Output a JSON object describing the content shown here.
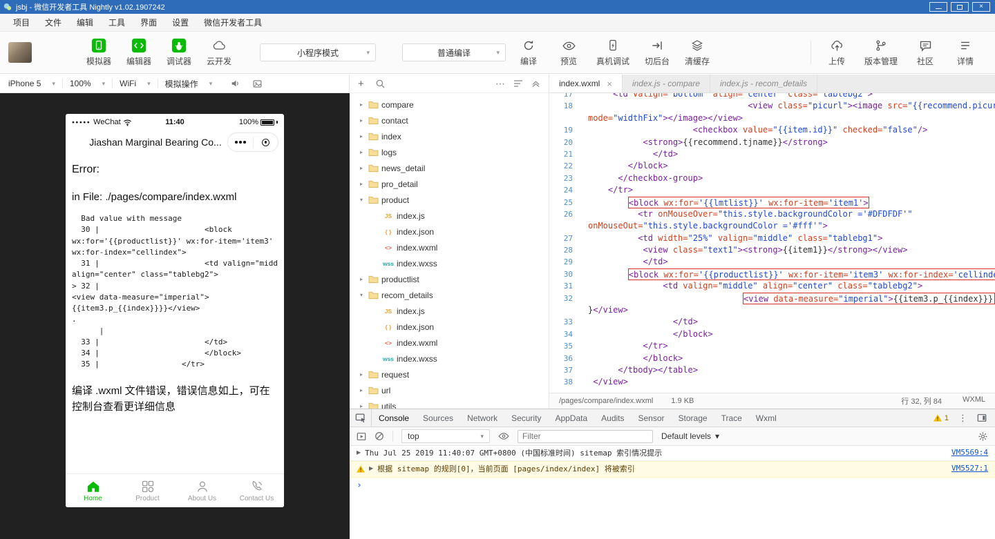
{
  "window": {
    "title": "jsbj - 微信开发者工具 Nightly v1.02.1907242"
  },
  "glyphs": {
    "close": "×",
    "caret_down": "▾",
    "tree_collapsed": "▸",
    "tree_expanded": "▾",
    "plus": "+",
    "ellipsis": "⋯",
    "menu_dots": "⋮",
    "disclosure": "▶",
    "prompt": "›"
  },
  "menu": {
    "items": [
      "项目",
      "文件",
      "编辑",
      "工具",
      "界面",
      "设置",
      "微信开发者工具"
    ]
  },
  "toolbar": {
    "mode_buttons": [
      {
        "label": "模拟器"
      },
      {
        "label": "编辑器"
      },
      {
        "label": "调试器"
      },
      {
        "label": "云开发"
      }
    ],
    "mode_select": "小程序模式",
    "compile_select": "普通编译",
    "actions": [
      {
        "label": "编译"
      },
      {
        "label": "预览"
      },
      {
        "label": "真机调试"
      },
      {
        "label": "切后台"
      },
      {
        "label": "清缓存"
      }
    ],
    "right_actions": [
      {
        "label": "上传"
      },
      {
        "label": "版本管理"
      },
      {
        "label": "社区"
      },
      {
        "label": "详情"
      }
    ],
    "accent_green": "#09bb07"
  },
  "simulator": {
    "device": "iPhone 5",
    "zoom": "100%",
    "network": "WiFi",
    "operate": "模拟操作"
  },
  "phone": {
    "status_left": "WeChat",
    "status_time": "11:40",
    "status_battery": "100%",
    "nav_title": "Jiashan Marginal Bearing Co...",
    "error_heading": "Error:",
    "error_file": "in File: ./pages/compare/index.wxml",
    "error_code": "  Bad value with message\n  30 |                       <block\nwx:for='{{productlist}}' wx:for-item='item3'\nwx:for-index=\"cellindex\">\n  31 |                       <td valign=\"middle\"\nalign=\"center\" class=\"tablebg2\">\n> 32 |\n<view data-measure=\"imperial\">\n{{item3.p_{{index}}}}</view>\n.\n      |\n  33 |                       </td>\n  34 |                       </block>\n  35 |                  </tr>",
    "error_footer": "编译 .wxml 文件错误，错误信息如上，可在控制台查看更详细信息",
    "tabbar": [
      {
        "label": "Home",
        "active": true
      },
      {
        "label": "Product",
        "active": false
      },
      {
        "label": "About Us",
        "active": false
      },
      {
        "label": "Contact Us",
        "active": false
      }
    ]
  },
  "tree": {
    "items": [
      {
        "name": "compare",
        "kind": "folder",
        "state": "collapsed",
        "depth": 0
      },
      {
        "name": "contact",
        "kind": "folder",
        "state": "collapsed",
        "depth": 0
      },
      {
        "name": "index",
        "kind": "folder",
        "state": "collapsed",
        "depth": 0
      },
      {
        "name": "logs",
        "kind": "folder",
        "state": "collapsed",
        "depth": 0
      },
      {
        "name": "news_detail",
        "kind": "folder",
        "state": "collapsed",
        "depth": 0
      },
      {
        "name": "pro_detail",
        "kind": "folder",
        "state": "collapsed",
        "depth": 0
      },
      {
        "name": "product",
        "kind": "folder",
        "state": "expanded",
        "depth": 0
      },
      {
        "name": "index.js",
        "kind": "js",
        "depth": 1
      },
      {
        "name": "index.json",
        "kind": "json",
        "depth": 1
      },
      {
        "name": "index.wxml",
        "kind": "wxml",
        "depth": 1
      },
      {
        "name": "index.wxss",
        "kind": "wxss",
        "depth": 1
      },
      {
        "name": "productlist",
        "kind": "folder",
        "state": "collapsed",
        "depth": 0
      },
      {
        "name": "recom_details",
        "kind": "folder",
        "state": "expanded",
        "depth": 0
      },
      {
        "name": "index.js",
        "kind": "js",
        "depth": 1
      },
      {
        "name": "index.json",
        "kind": "json",
        "depth": 1
      },
      {
        "name": "index.wxml",
        "kind": "wxml",
        "depth": 1
      },
      {
        "name": "index.wxss",
        "kind": "wxss",
        "depth": 1
      },
      {
        "name": "request",
        "kind": "folder",
        "state": "collapsed",
        "depth": 0
      },
      {
        "name": "url",
        "kind": "folder",
        "state": "collapsed",
        "depth": 0
      },
      {
        "name": "utils",
        "kind": "folder",
        "state": "collapsed",
        "depth": 0
      }
    ],
    "file_icon_styles": {
      "js": {
        "text": "JS",
        "color": "#e8a33d"
      },
      "json": {
        "text": "{ }",
        "color": "#e8a33d"
      },
      "wxml": {
        "text": "<>",
        "color": "#e25f43"
      },
      "wxss": {
        "text": "wss",
        "color": "#2aa7a0"
      }
    }
  },
  "editor": {
    "tabs": [
      {
        "label": "index.wxml",
        "active": true,
        "closable": true
      },
      {
        "label": "index.js - compare",
        "active": false
      },
      {
        "label": "index.js - recom_details",
        "active": false
      }
    ],
    "status": {
      "path": "/pages/compare/index.wxml",
      "size": "1.9 KB",
      "position": "行 32, 列 84",
      "lang": "WXML"
    },
    "rows": [
      {
        "n": 17,
        "ind": 5,
        "tk": [
          [
            "t",
            "<td "
          ],
          [
            "a",
            "valign="
          ],
          [
            "s",
            "\"bottom\""
          ],
          [
            "p",
            " "
          ],
          [
            "a",
            "align="
          ],
          [
            "s",
            "\"center\""
          ],
          [
            "p",
            " "
          ],
          [
            "a",
            "class="
          ],
          [
            "s",
            "\"tablebg2\""
          ],
          [
            "t",
            ">"
          ]
        ]
      },
      {
        "n": 18,
        "ind": 32,
        "tk": [
          [
            "t",
            "<view "
          ],
          [
            "a",
            "class="
          ],
          [
            "s",
            "\"picurl\""
          ],
          [
            "t",
            "><image "
          ],
          [
            "a",
            "src="
          ],
          [
            "s",
            "\"{{recommend.picurl}}\""
          ]
        ]
      },
      {
        "ind": 0,
        "tk": [
          [
            "a",
            "mode="
          ],
          [
            "s",
            "\"widthFix\""
          ],
          [
            "t",
            "></image></view>"
          ]
        ]
      },
      {
        "n": 19,
        "ind": 21,
        "tk": [
          [
            "t",
            "<checkbox "
          ],
          [
            "a",
            "value="
          ],
          [
            "s",
            "\"{{item.id}}\""
          ],
          [
            "p",
            " "
          ],
          [
            "a",
            "checked="
          ],
          [
            "s",
            "\"false\""
          ],
          [
            "t",
            "/>"
          ]
        ]
      },
      {
        "n": 20,
        "ind": 11,
        "tk": [
          [
            "t",
            "<strong>"
          ],
          [
            "p",
            "{{recommend.tjname}}"
          ],
          [
            "t",
            "</strong>"
          ]
        ]
      },
      {
        "n": 21,
        "ind": 13,
        "tk": [
          [
            "t",
            "</td>"
          ]
        ]
      },
      {
        "n": 22,
        "ind": 8,
        "tk": [
          [
            "t",
            "</block>"
          ]
        ]
      },
      {
        "n": 23,
        "ind": 6,
        "tk": [
          [
            "t",
            "</checkbox-group>"
          ]
        ]
      },
      {
        "n": 24,
        "ind": 4,
        "tk": [
          [
            "t",
            "</tr>"
          ]
        ]
      },
      {
        "n": 25,
        "ind": 8,
        "box": "fit",
        "tk": [
          [
            "t",
            "<block "
          ],
          [
            "a",
            "wx:for="
          ],
          [
            "s",
            "'{{lmtlist}}'"
          ],
          [
            "p",
            " "
          ],
          [
            "a",
            "wx:for-item="
          ],
          [
            "s",
            "'item1'"
          ],
          [
            "t",
            ">"
          ]
        ]
      },
      {
        "n": 26,
        "ind": 10,
        "tk": [
          [
            "t",
            "<tr "
          ],
          [
            "a",
            "onMouseOver="
          ],
          [
            "s",
            "\"this.style.backgroundColor ='#DFDFDF'\""
          ]
        ]
      },
      {
        "ind": 0,
        "tk": [
          [
            "a",
            "onMouseOut="
          ],
          [
            "s",
            "\"this.style.backgroundColor ='#fff'\""
          ],
          [
            "t",
            ">"
          ]
        ]
      },
      {
        "n": 27,
        "ind": 10,
        "tk": [
          [
            "t",
            "<td "
          ],
          [
            "a",
            "width="
          ],
          [
            "s",
            "\"25%\""
          ],
          [
            "p",
            " "
          ],
          [
            "a",
            "valign="
          ],
          [
            "s",
            "\"middle\""
          ],
          [
            "p",
            " "
          ],
          [
            "a",
            "class="
          ],
          [
            "s",
            "\"tablebg1\""
          ],
          [
            "t",
            ">"
          ]
        ]
      },
      {
        "n": 28,
        "ind": 11,
        "tk": [
          [
            "t",
            "<view "
          ],
          [
            "a",
            "class="
          ],
          [
            "s",
            "\"text1\""
          ],
          [
            "t",
            "><strong>"
          ],
          [
            "p",
            "{{item1}}"
          ],
          [
            "t",
            "</strong></view>"
          ]
        ]
      },
      {
        "n": 29,
        "ind": 11,
        "tk": [
          [
            "t",
            "</td>"
          ]
        ]
      },
      {
        "n": 30,
        "ind": 8,
        "box": "stretch",
        "tk": [
          [
            "t",
            "<block "
          ],
          [
            "a",
            "wx:for="
          ],
          [
            "s",
            "'{{productlist}}'"
          ],
          [
            "p",
            " "
          ],
          [
            "a",
            "wx:for-item="
          ],
          [
            "s",
            "'item3'"
          ],
          [
            "p",
            " "
          ],
          [
            "a",
            "wx:for-index="
          ],
          [
            "s",
            "'cellindex'"
          ],
          [
            "t",
            ">"
          ]
        ]
      },
      {
        "n": 31,
        "ind": 15,
        "tk": [
          [
            "t",
            "<td "
          ],
          [
            "a",
            "valign="
          ],
          [
            "s",
            "\"middle\""
          ],
          [
            "p",
            " "
          ],
          [
            "a",
            "align="
          ],
          [
            "s",
            "\"center\""
          ],
          [
            "p",
            " "
          ],
          [
            "a",
            "class="
          ],
          [
            "s",
            "\"tablebg2\""
          ],
          [
            "t",
            ">"
          ]
        ]
      },
      {
        "n": 32,
        "ind": 31,
        "box": "stretch",
        "tk": [
          [
            "t",
            "<view "
          ],
          [
            "a",
            "data-measure="
          ],
          [
            "s",
            "\"imperial\""
          ],
          [
            "t",
            ">"
          ],
          [
            "p",
            "{{item3.p_{{index}}}"
          ]
        ]
      },
      {
        "ind": 0,
        "tk": [
          [
            "p",
            "}"
          ],
          [
            "t",
            "</view>"
          ]
        ]
      },
      {
        "n": 33,
        "ind": 17,
        "tk": [
          [
            "t",
            "</td>"
          ]
        ]
      },
      {
        "n": 34,
        "ind": 17,
        "tk": [
          [
            "t",
            "</block>"
          ]
        ]
      },
      {
        "n": 35,
        "ind": 11,
        "tk": [
          [
            "t",
            "</tr>"
          ]
        ]
      },
      {
        "n": 36,
        "ind": 11,
        "tk": [
          [
            "t",
            "</block>"
          ]
        ]
      },
      {
        "n": 37,
        "ind": 6,
        "tk": [
          [
            "t",
            "</tbody></table>"
          ]
        ]
      },
      {
        "n": 38,
        "ind": 1,
        "tk": [
          [
            "t",
            "</view>"
          ]
        ]
      }
    ],
    "error_box_color": "#d93025"
  },
  "devtools": {
    "tabs": [
      "Console",
      "Sources",
      "Network",
      "Security",
      "AppData",
      "Audits",
      "Sensor",
      "Storage",
      "Trace",
      "Wxml"
    ],
    "active_tab": "Console",
    "warning_count": "1",
    "context": "top",
    "filter_placeholder": "Filter",
    "levels": "Default levels"
  },
  "console": {
    "messages": [
      {
        "level": "log",
        "text": "Thu Jul 25 2019 11:40:07 GMT+0800 (中国标准时间) sitemap 索引情况提示",
        "link": "VM5569:4"
      },
      {
        "level": "warning",
        "text": "根据 sitemap 的规则[0]，当前页面 [pages/index/index] 将被索引",
        "link": "VM5527:1"
      }
    ]
  }
}
